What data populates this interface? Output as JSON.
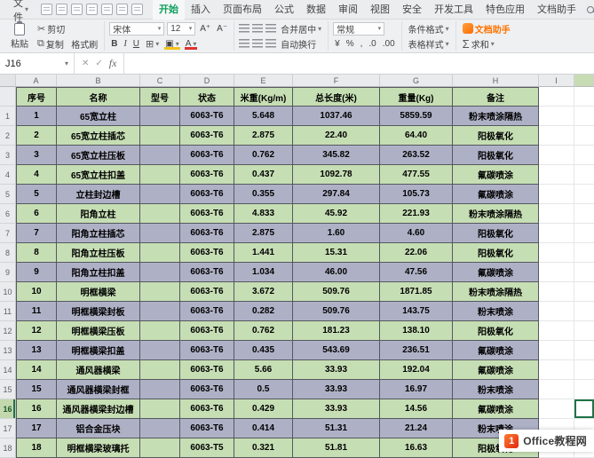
{
  "menu": {
    "file_label": "文件",
    "tabs": [
      "开始",
      "插入",
      "页面布局",
      "公式",
      "数据",
      "审阅",
      "视图",
      "安全",
      "开发工具",
      "特色应用",
      "文档助手"
    ],
    "active_tab": "开始",
    "find_label": "查找"
  },
  "toolbar": {
    "paste": "粘贴",
    "cut": "剪切",
    "copy": "复制",
    "format_painter": "格式刷",
    "font_name": "宋体",
    "font_size": "12",
    "merge_center": "合并居中",
    "wrap_text": "自动换行",
    "number_format": "常规",
    "currency": "¥",
    "percent": "%",
    "comma": ",",
    "dec_add": ".0",
    "dec_sub": ".00",
    "conditional_format": "条件格式",
    "table_style": "表格样式",
    "doc_assistant": "文档助手",
    "sum_label": "求和"
  },
  "formula_bar": {
    "name_box": "J16",
    "fx_label": "fx",
    "formula_value": ""
  },
  "grid": {
    "column_letters": [
      "A",
      "B",
      "C",
      "D",
      "E",
      "F",
      "G",
      "H",
      "I"
    ],
    "headers": [
      "序号",
      "名称",
      "型号",
      "状态",
      "米重(Kg/m)",
      "总长度(米)",
      "重量(Kg)",
      "备注"
    ],
    "rows": [
      [
        "1",
        "65宽立柱",
        "",
        "6063-T6",
        "5.648",
        "1037.46",
        "5859.59",
        "粉末喷涂隔热"
      ],
      [
        "2",
        "65宽立柱插芯",
        "",
        "6063-T6",
        "2.875",
        "22.40",
        "64.40",
        "阳极氧化"
      ],
      [
        "3",
        "65宽立柱压板",
        "",
        "6063-T6",
        "0.762",
        "345.82",
        "263.52",
        "阳极氧化"
      ],
      [
        "4",
        "65宽立柱扣盖",
        "",
        "6063-T6",
        "0.437",
        "1092.78",
        "477.55",
        "氟碳喷涂"
      ],
      [
        "5",
        "立柱封边槽",
        "",
        "6063-T6",
        "0.355",
        "297.84",
        "105.73",
        "氟碳喷涂"
      ],
      [
        "6",
        "阳角立柱",
        "",
        "6063-T6",
        "4.833",
        "45.92",
        "221.93",
        "粉末喷涂隔热"
      ],
      [
        "7",
        "阳角立柱插芯",
        "",
        "6063-T6",
        "2.875",
        "1.60",
        "4.60",
        "阳极氧化"
      ],
      [
        "8",
        "阳角立柱压板",
        "",
        "6063-T6",
        "1.441",
        "15.31",
        "22.06",
        "阳极氧化"
      ],
      [
        "9",
        "阳角立柱扣盖",
        "",
        "6063-T6",
        "1.034",
        "46.00",
        "47.56",
        "氟碳喷涂"
      ],
      [
        "10",
        "明框横梁",
        "",
        "6063-T6",
        "3.672",
        "509.76",
        "1871.85",
        "粉末喷涂隔热"
      ],
      [
        "11",
        "明框横梁封板",
        "",
        "6063-T6",
        "0.282",
        "509.76",
        "143.75",
        "粉末喷涂"
      ],
      [
        "12",
        "明框横梁压板",
        "",
        "6063-T6",
        "0.762",
        "181.23",
        "138.10",
        "阳极氧化"
      ],
      [
        "13",
        "明框横梁扣盖",
        "",
        "6063-T6",
        "0.435",
        "543.69",
        "236.51",
        "氟碳喷涂"
      ],
      [
        "14",
        "通风器横梁",
        "",
        "6063-T6",
        "5.66",
        "33.93",
        "192.04",
        "氟碳喷涂"
      ],
      [
        "15",
        "通风器横梁封框",
        "",
        "6063-T6",
        "0.5",
        "33.93",
        "16.97",
        "粉末喷涂"
      ],
      [
        "16",
        "通风器横梁封边槽",
        "",
        "6063-T6",
        "0.429",
        "33.93",
        "14.56",
        "氟碳喷涂"
      ],
      [
        "17",
        "铝合金压块",
        "",
        "6063-T6",
        "0.414",
        "51.31",
        "21.24",
        "粉末喷涂"
      ],
      [
        "18",
        "明框横梁玻璃托",
        "",
        "6063-T5",
        "0.321",
        "51.81",
        "16.63",
        "阳极氧化"
      ]
    ],
    "selected_cell": "J16",
    "selected_row": 16
  },
  "watermark": {
    "badge": "1",
    "text": "Office教程网"
  },
  "colors": {
    "row_gray": "#aeb1c6",
    "row_green": "#c6deb4",
    "selection_green": "#217346",
    "active_tab_green": "#10a15e",
    "assistant_orange": "#ff7300",
    "watermark_red": "#e02a0f"
  }
}
